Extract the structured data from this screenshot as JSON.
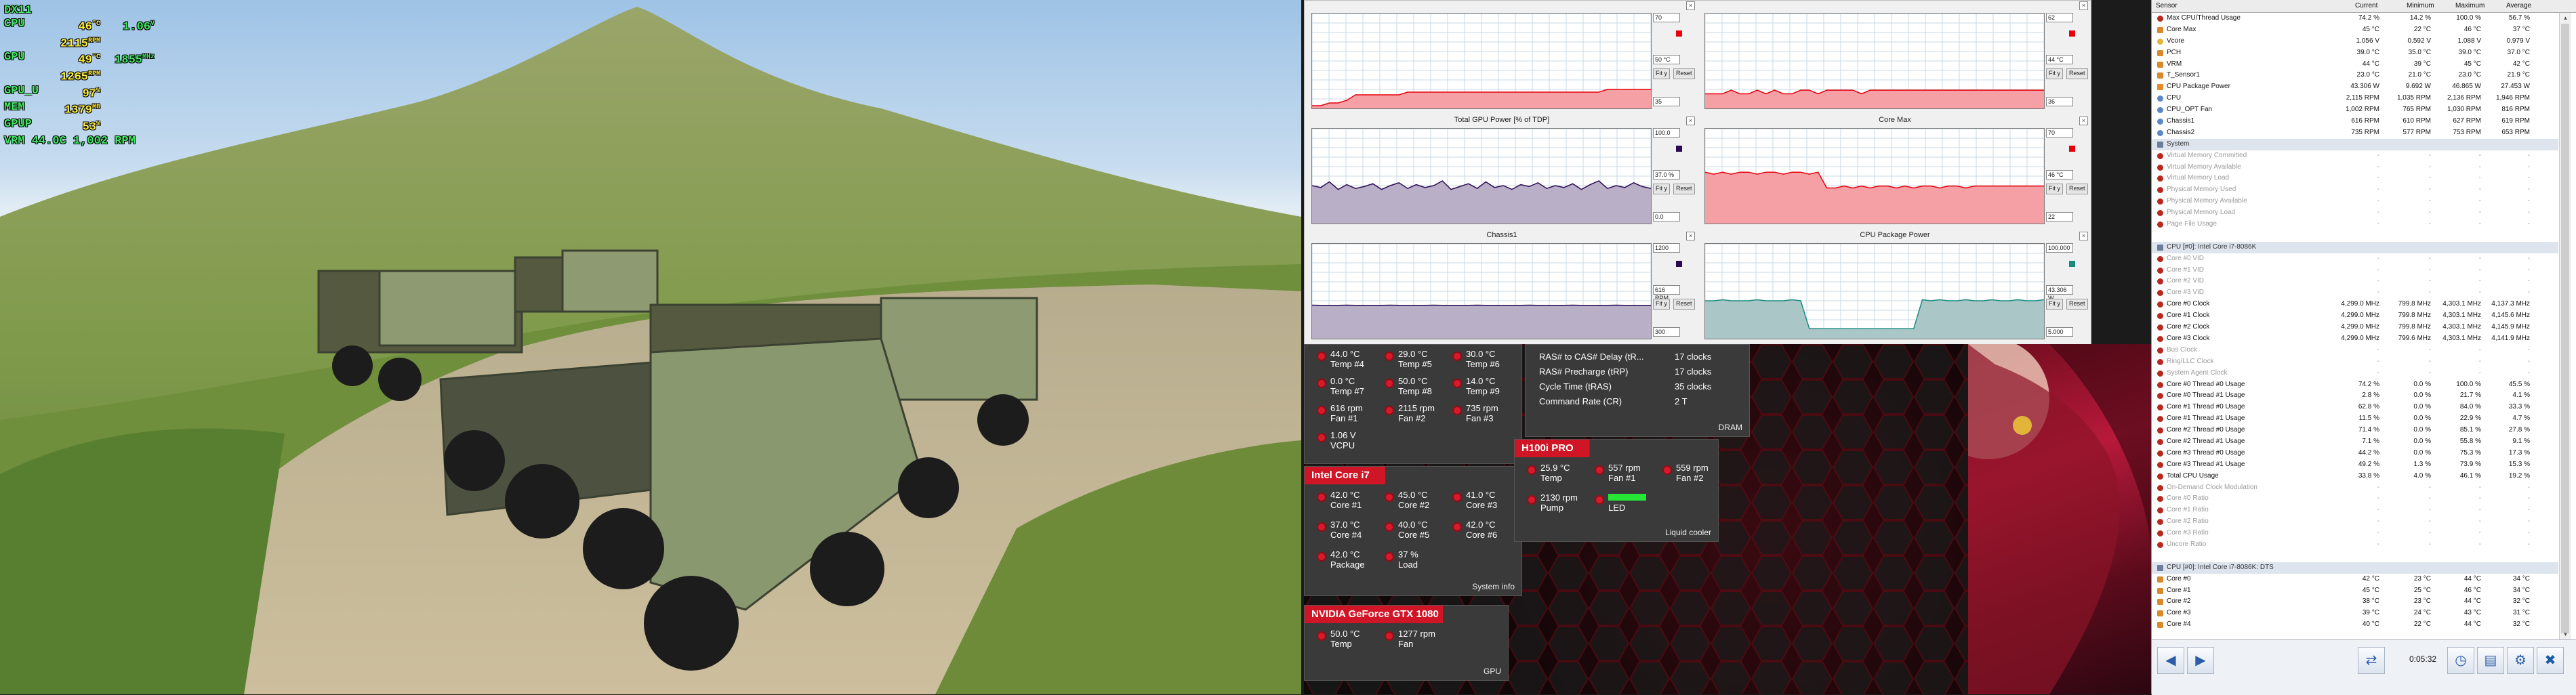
{
  "osd": {
    "rows": [
      {
        "label": "DX11",
        "v1": "",
        "u1": "",
        "v2": "",
        "u2": ""
      },
      {
        "label": "CPU",
        "v1": "46",
        "u1": "°C",
        "v2": "1.06",
        "u2": "V"
      },
      {
        "label": "",
        "v1": "2115",
        "u1": "RPM",
        "v2": "",
        "u2": ""
      },
      {
        "label": "GPU",
        "v1": "49",
        "u1": "°C",
        "v2": "1855",
        "u2": "MHz"
      },
      {
        "label": "",
        "v1": "1265",
        "u1": "RPM",
        "v2": "",
        "u2": ""
      },
      {
        "label": "GPU_U",
        "v1": "97",
        "u1": "%",
        "v2": "",
        "u2": ""
      },
      {
        "label": "MEM",
        "v1": "1379",
        "u1": "MB",
        "v2": "",
        "u2": ""
      },
      {
        "label": "GPUP",
        "v1": "53",
        "u1": "%",
        "v2": "",
        "u2": ""
      }
    ],
    "footer": "VRM 44.0C 1,002 RPM"
  },
  "graphs": [
    {
      "title": "",
      "max": "70",
      "cur": "50 °C",
      "min": "35",
      "color": "#e8000a",
      "fill": "#f5a0a5",
      "fit": "Fit y",
      "reset": "Reset",
      "series": [
        36,
        36,
        37,
        37,
        38,
        40,
        40,
        40,
        40,
        40,
        40,
        41,
        41,
        41,
        41,
        41,
        41,
        41,
        41,
        41,
        41,
        41,
        41,
        41,
        41,
        41,
        41,
        41,
        41,
        41,
        41,
        41,
        41,
        41,
        42,
        42,
        42,
        42,
        42,
        42
      ]
    },
    {
      "title": "",
      "max": "62",
      "cur": "44 °C",
      "min": "36",
      "color": "#e8000a",
      "fill": "#f5a0a5",
      "fit": "Fit y",
      "reset": "Reset",
      "series": [
        40,
        40,
        40,
        41,
        40,
        40,
        41,
        40,
        41,
        40,
        40,
        41,
        41,
        40,
        41,
        41,
        41,
        41,
        40,
        41,
        41,
        41,
        41,
        41,
        41,
        41,
        41,
        41,
        41,
        41,
        41,
        41,
        41,
        41,
        41,
        41,
        41,
        41,
        41,
        41
      ]
    },
    {
      "title": "Total GPU Power [% of TDP]",
      "max": "100.0",
      "cur": "37.0 %",
      "min": "0.0",
      "color": "#2a0a52",
      "fill": "#b9b0c8",
      "fit": "Fit y",
      "reset": "Reset",
      "series": [
        40,
        38,
        44,
        36,
        41,
        37,
        39,
        42,
        36,
        40,
        43,
        37,
        41,
        38,
        40,
        45,
        36,
        39,
        42,
        37,
        44,
        38,
        40,
        36,
        41,
        39,
        43,
        37,
        40,
        38,
        42,
        36,
        41,
        45,
        37,
        40,
        38,
        43,
        39,
        37
      ]
    },
    {
      "title": "Core Max",
      "max": "70",
      "cur": "46 °C",
      "min": "22",
      "color": "#e8000a",
      "fill": "#f5a0a5",
      "fit": "Fit y",
      "reset": "Reset",
      "series": [
        48,
        47,
        48,
        47,
        48,
        48,
        47,
        48,
        48,
        47,
        48,
        48,
        47,
        48,
        40,
        40,
        41,
        40,
        41,
        40,
        41,
        41,
        40,
        41,
        40,
        41,
        41,
        40,
        41,
        41,
        40,
        41,
        41,
        41,
        41,
        41,
        41,
        41,
        41,
        41
      ]
    },
    {
      "title": "Chassis1",
      "max": "1200",
      "cur": "616 RPM",
      "min": "300",
      "color": "#2a0a52",
      "fill": "#b9b0c8",
      "fit": "Fit y",
      "reset": "Reset",
      "series": [
        618,
        616,
        617,
        616,
        618,
        617,
        616,
        617,
        616,
        618,
        616,
        617,
        616,
        617,
        618,
        616,
        617,
        616,
        617,
        618,
        616,
        617,
        616,
        617,
        616,
        618,
        617,
        616,
        617,
        616,
        618,
        617,
        616,
        617,
        616,
        618,
        617,
        616,
        617,
        616
      ]
    },
    {
      "title": "CPU Package Power",
      "max": "100.000",
      "cur": "43.306 W",
      "min": "5.000",
      "color": "#1a8a80",
      "fill": "#aac6c7",
      "fit": "Fit y",
      "reset": "Reset",
      "series": [
        43,
        43,
        44,
        43,
        43,
        43,
        44,
        43,
        43,
        43,
        44,
        43,
        15,
        15,
        15,
        15,
        15,
        15,
        15,
        15,
        15,
        15,
        15,
        15,
        15,
        44,
        43,
        44,
        43,
        43,
        44,
        43,
        43,
        44,
        43,
        43,
        44,
        43,
        43,
        44
      ]
    }
  ],
  "msi": {
    "temps_top": [
      {
        "v": "44.0 °C",
        "l": "Temp #4"
      },
      {
        "v": "29.0 °C",
        "l": "Temp #5"
      },
      {
        "v": "30.0 °C",
        "l": "Temp #6"
      },
      {
        "v": "0.0 °C",
        "l": "Temp #7"
      },
      {
        "v": "50.0 °C",
        "l": "Temp #8"
      },
      {
        "v": "14.0 °C",
        "l": "Temp #9"
      },
      {
        "v": "616 rpm",
        "l": "Fan #1"
      },
      {
        "v": "2115 rpm",
        "l": "Fan #2"
      },
      {
        "v": "735 rpm",
        "l": "Fan #3"
      },
      {
        "v": "1.06 V",
        "l": "VCPU"
      }
    ],
    "dram": {
      "rows": [
        {
          "l": "RAS# to CAS# Delay (tR...",
          "v": "17 clocks"
        },
        {
          "l": "RAS# Precharge (tRP)",
          "v": "17 clocks"
        },
        {
          "l": "Cycle Time (tRAS)",
          "v": "35 clocks"
        },
        {
          "l": "Command Rate (CR)",
          "v": "2 T"
        }
      ],
      "foot": "DRAM"
    },
    "cpu": {
      "title": "Intel Core i7",
      "items": [
        {
          "v": "42.0 °C",
          "l": "Core #1"
        },
        {
          "v": "45.0 °C",
          "l": "Core #2"
        },
        {
          "v": "41.0 °C",
          "l": "Core #3"
        },
        {
          "v": "37.0 °C",
          "l": "Core #4"
        },
        {
          "v": "40.0 °C",
          "l": "Core #5"
        },
        {
          "v": "42.0 °C",
          "l": "Core #6"
        },
        {
          "v": "42.0 °C",
          "l": "Package"
        },
        {
          "v": "37 %",
          "l": "Load"
        }
      ],
      "foot": "System info"
    },
    "cooler": {
      "title": "H100i PRO",
      "items": [
        {
          "v": "25.9 °C",
          "l": "Temp"
        },
        {
          "v": "557 rpm",
          "l": "Fan #1"
        },
        {
          "v": "559 rpm",
          "l": "Fan #2"
        },
        {
          "v": "2130 rpm",
          "l": "Pump"
        },
        {
          "v": "",
          "l": "LED"
        }
      ],
      "foot": "Liquid cooler"
    },
    "gpu": {
      "title": "NVIDIA GeForce GTX 1080",
      "items": [
        {
          "v": "50.0 °C",
          "l": "Temp"
        },
        {
          "v": "1277 rpm",
          "l": "Fan"
        }
      ],
      "foot": "GPU"
    }
  },
  "hw": {
    "headers": [
      "Sensor",
      "Current",
      "Minimum",
      "Maximum",
      "Average"
    ],
    "rows": [
      {
        "i": "c",
        "n": "Max CPU/Thread Usage",
        "c": "74.2 %",
        "mi": "14.2 %",
        "ma": "100.0 %",
        "a": "56.7 %"
      },
      {
        "i": "t",
        "n": "Core Max",
        "c": "45 °C",
        "mi": "22 °C",
        "ma": "46 °C",
        "a": "37 °C"
      },
      {
        "i": "v",
        "n": "Vcore",
        "c": "1.056 V",
        "mi": "0.592 V",
        "ma": "1.088 V",
        "a": "0.979 V"
      },
      {
        "i": "t",
        "n": "PCH",
        "c": "39.0 °C",
        "mi": "35.0 °C",
        "ma": "39.0 °C",
        "a": "37.0 °C"
      },
      {
        "i": "t",
        "n": "VRM",
        "c": "44 °C",
        "mi": "39 °C",
        "ma": "45 °C",
        "a": "42 °C"
      },
      {
        "i": "t",
        "n": "T_Sensor1",
        "c": "23.0 °C",
        "mi": "21.0 °C",
        "ma": "23.0 °C",
        "a": "21.9 °C"
      },
      {
        "i": "p",
        "n": "CPU Package Power",
        "c": "43.306 W",
        "mi": "9.692 W",
        "ma": "46.865 W",
        "a": "27.453 W"
      },
      {
        "i": "f",
        "n": "CPU",
        "c": "2,115 RPM",
        "mi": "1,035 RPM",
        "ma": "2,136 RPM",
        "a": "1,946 RPM"
      },
      {
        "i": "f",
        "n": "CPU_OPT Fan",
        "c": "1,002 RPM",
        "mi": "765 RPM",
        "ma": "1,030 RPM",
        "a": "816 RPM"
      },
      {
        "i": "f",
        "n": "Chassis1",
        "c": "616 RPM",
        "mi": "610 RPM",
        "ma": "627 RPM",
        "a": "619 RPM"
      },
      {
        "i": "f",
        "n": "Chassis2",
        "c": "735 RPM",
        "mi": "577 RPM",
        "ma": "753 RPM",
        "a": "653 RPM"
      },
      {
        "g": true,
        "n": "System",
        "c": "",
        "mi": "",
        "ma": "",
        "a": ""
      },
      {
        "d": true,
        "n": "Virtual Memory Committed",
        "c": "-",
        "mi": "-",
        "ma": "-",
        "a": "-"
      },
      {
        "d": true,
        "n": "Virtual Memory Available",
        "c": "-",
        "mi": "-",
        "ma": "-",
        "a": "-"
      },
      {
        "d": true,
        "n": "Virtual Memory Load",
        "c": "-",
        "mi": "-",
        "ma": "-",
        "a": "-"
      },
      {
        "d": true,
        "n": "Physical Memory Used",
        "c": "-",
        "mi": "-",
        "ma": "-",
        "a": "-"
      },
      {
        "d": true,
        "n": "Physical Memory Available",
        "c": "-",
        "mi": "-",
        "ma": "-",
        "a": "-"
      },
      {
        "d": true,
        "n": "Physical Memory Load",
        "c": "-",
        "mi": "-",
        "ma": "-",
        "a": "-"
      },
      {
        "d": true,
        "n": "Page File Usage",
        "c": "-",
        "mi": "-",
        "ma": "-",
        "a": "-"
      },
      {
        "b": true,
        "n": "",
        "c": "",
        "mi": "",
        "ma": "",
        "a": ""
      },
      {
        "g": true,
        "n": "CPU [#0]: Intel Core i7-8086K",
        "c": "",
        "mi": "",
        "ma": "",
        "a": ""
      },
      {
        "d": true,
        "n": "Core #0 VID",
        "c": "-",
        "mi": "-",
        "ma": "-",
        "a": "-"
      },
      {
        "d": true,
        "n": "Core #1 VID",
        "c": "-",
        "mi": "-",
        "ma": "-",
        "a": "-"
      },
      {
        "d": true,
        "n": "Core #2 VID",
        "c": "-",
        "mi": "-",
        "ma": "-",
        "a": "-"
      },
      {
        "d": true,
        "n": "Core #3 VID",
        "c": "-",
        "mi": "-",
        "ma": "-",
        "a": "-"
      },
      {
        "i": "c",
        "n": "Core #0 Clock",
        "c": "4,299.0 MHz",
        "mi": "799.8 MHz",
        "ma": "4,303.1 MHz",
        "a": "4,137.3 MHz"
      },
      {
        "i": "c",
        "n": "Core #1 Clock",
        "c": "4,299.0 MHz",
        "mi": "799.8 MHz",
        "ma": "4,303.1 MHz",
        "a": "4,145.6 MHz"
      },
      {
        "i": "c",
        "n": "Core #2 Clock",
        "c": "4,299.0 MHz",
        "mi": "799.8 MHz",
        "ma": "4,303.1 MHz",
        "a": "4,145.9 MHz"
      },
      {
        "i": "c",
        "n": "Core #3 Clock",
        "c": "4,299.0 MHz",
        "mi": "799.6 MHz",
        "ma": "4,303.1 MHz",
        "a": "4,141.9 MHz"
      },
      {
        "d": true,
        "n": "Bus Clock",
        "c": "-",
        "mi": "-",
        "ma": "-",
        "a": "-"
      },
      {
        "d": true,
        "n": "Ring/LLC Clock",
        "c": "-",
        "mi": "-",
        "ma": "-",
        "a": "-"
      },
      {
        "d": true,
        "n": "System Agent Clock",
        "c": "-",
        "mi": "-",
        "ma": "-",
        "a": "-"
      },
      {
        "i": "c",
        "n": "Core #0 Thread #0 Usage",
        "c": "74.2 %",
        "mi": "0.0 %",
        "ma": "100.0 %",
        "a": "45.5 %"
      },
      {
        "i": "c",
        "n": "Core #0 Thread #1 Usage",
        "c": "2.8 %",
        "mi": "0.0 %",
        "ma": "21.7 %",
        "a": "4.1 %"
      },
      {
        "i": "c",
        "n": "Core #1 Thread #0 Usage",
        "c": "62.8 %",
        "mi": "0.0 %",
        "ma": "84.0 %",
        "a": "33.3 %"
      },
      {
        "i": "c",
        "n": "Core #1 Thread #1 Usage",
        "c": "11.5 %",
        "mi": "0.0 %",
        "ma": "22.9 %",
        "a": "4.7 %"
      },
      {
        "i": "c",
        "n": "Core #2 Thread #0 Usage",
        "c": "71.4 %",
        "mi": "0.0 %",
        "ma": "85.1 %",
        "a": "27.8 %"
      },
      {
        "i": "c",
        "n": "Core #2 Thread #1 Usage",
        "c": "7.1 %",
        "mi": "0.0 %",
        "ma": "55.8 %",
        "a": "9.1 %"
      },
      {
        "i": "c",
        "n": "Core #3 Thread #0 Usage",
        "c": "44.2 %",
        "mi": "0.0 %",
        "ma": "75.3 %",
        "a": "17.3 %"
      },
      {
        "i": "c",
        "n": "Core #3 Thread #1 Usage",
        "c": "49.2 %",
        "mi": "1.3 %",
        "ma": "73.9 %",
        "a": "15.3 %"
      },
      {
        "i": "c",
        "n": "Total CPU Usage",
        "c": "33.8 %",
        "mi": "4.0 %",
        "ma": "46.1 %",
        "a": "19.2 %"
      },
      {
        "d": true,
        "n": "On-Demand Clock Modulation",
        "c": "-",
        "mi": "-",
        "ma": "-",
        "a": "-"
      },
      {
        "d": true,
        "n": "Core #0 Ratio",
        "c": "-",
        "mi": "-",
        "ma": "-",
        "a": "-"
      },
      {
        "d": true,
        "n": "Core #1 Ratio",
        "c": "-",
        "mi": "-",
        "ma": "-",
        "a": "-"
      },
      {
        "d": true,
        "n": "Core #2 Ratio",
        "c": "-",
        "mi": "-",
        "ma": "-",
        "a": "-"
      },
      {
        "d": true,
        "n": "Core #3 Ratio",
        "c": "-",
        "mi": "-",
        "ma": "-",
        "a": "-"
      },
      {
        "d": true,
        "n": "Uncore Ratio",
        "c": "-",
        "mi": "-",
        "ma": "-",
        "a": "-"
      },
      {
        "b": true,
        "n": "",
        "c": "",
        "mi": "",
        "ma": "",
        "a": ""
      },
      {
        "g": true,
        "n": "CPU [#0]: Intel Core i7-8086K: DTS",
        "c": "",
        "mi": "",
        "ma": "",
        "a": ""
      },
      {
        "i": "t",
        "n": "Core #0",
        "c": "42 °C",
        "mi": "23 °C",
        "ma": "44 °C",
        "a": "34 °C"
      },
      {
        "i": "t",
        "n": "Core #1",
        "c": "45 °C",
        "mi": "25 °C",
        "ma": "46 °C",
        "a": "34 °C"
      },
      {
        "i": "t",
        "n": "Core #2",
        "c": "38 °C",
        "mi": "23 °C",
        "ma": "44 °C",
        "a": "32 °C"
      },
      {
        "i": "t",
        "n": "Core #3",
        "c": "39 °C",
        "mi": "24 °C",
        "ma": "43 °C",
        "a": "31 °C"
      },
      {
        "i": "t",
        "n": "Core #4",
        "c": "40 °C",
        "mi": "22 °C",
        "ma": "44 °C",
        "a": "32 °C"
      }
    ],
    "time": "0:05:32"
  }
}
